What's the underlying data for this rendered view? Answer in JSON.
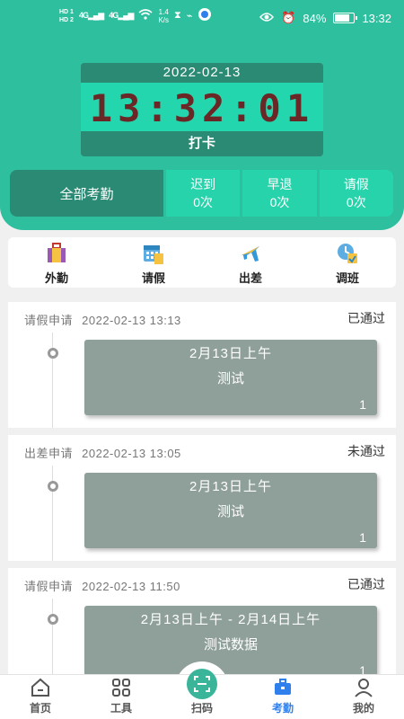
{
  "status_bar": {
    "hd1": "HD 1",
    "hd2": "HD 2",
    "sig1": "4G",
    "sig2": "4G",
    "speed_value": "1.4",
    "speed_unit": "K/s",
    "battery": "84%",
    "battery_level": 0.84,
    "time": "13:32"
  },
  "clock": {
    "date": "2022-02-13",
    "time": "13:32:01",
    "punch_label": "打卡"
  },
  "stats": {
    "all": "全部考勤",
    "items": [
      {
        "label": "迟到",
        "value": "0次"
      },
      {
        "label": "早退",
        "value": "0次"
      },
      {
        "label": "请假",
        "value": "0次"
      }
    ]
  },
  "quick_actions": [
    {
      "label": "外勤",
      "icon": "luggage-icon"
    },
    {
      "label": "请假",
      "icon": "calendar-icon"
    },
    {
      "label": "出差",
      "icon": "airplane-icon"
    },
    {
      "label": "调班",
      "icon": "schedule-swap-icon"
    }
  ],
  "records": [
    {
      "type": "请假申请",
      "datetime": "2022-02-13 13:13",
      "status": "已通过",
      "title": "2月13日上午",
      "desc": "测试",
      "count": "1"
    },
    {
      "type": "出差申请",
      "datetime": "2022-02-13 13:05",
      "status": "未通过",
      "title": "2月13日上午",
      "desc": "测试",
      "count": "1"
    },
    {
      "type": "请假申请",
      "datetime": "2022-02-13 11:50",
      "status": "已通过",
      "title": "2月13日上午 - 2月14日上午",
      "desc": "测试数据",
      "count": "1"
    }
  ],
  "nav": {
    "home": "首页",
    "tools": "工具",
    "scan": "扫码",
    "attendance": "考勤",
    "mine": "我的"
  },
  "colors": {
    "primary": "#2ebf9f",
    "dark": "#2a8a74",
    "active": "#2f80ed",
    "card": "#8f9f99"
  }
}
